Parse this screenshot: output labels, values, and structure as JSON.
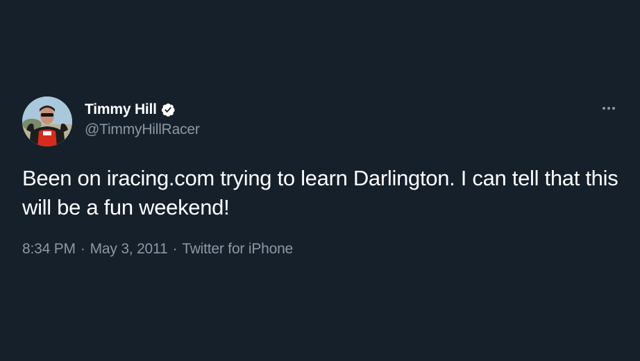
{
  "tweet": {
    "author": {
      "display_name": "Timmy Hill",
      "handle": "@TimmyHillRacer",
      "verified": true,
      "verified_icon": "verified-badge-icon",
      "avatar_icon": "avatar-photo"
    },
    "more_icon": "more-options-icon",
    "text": "Been on iracing.com trying to learn Darlington. I can tell that this will be a fun weekend!",
    "time": "8:34 PM",
    "date": "May 3, 2011",
    "source": "Twitter for iPhone",
    "separator": "·"
  },
  "colors": {
    "background": "#15202b",
    "primary_text": "#ffffff",
    "secondary_text": "#8b98a5"
  }
}
